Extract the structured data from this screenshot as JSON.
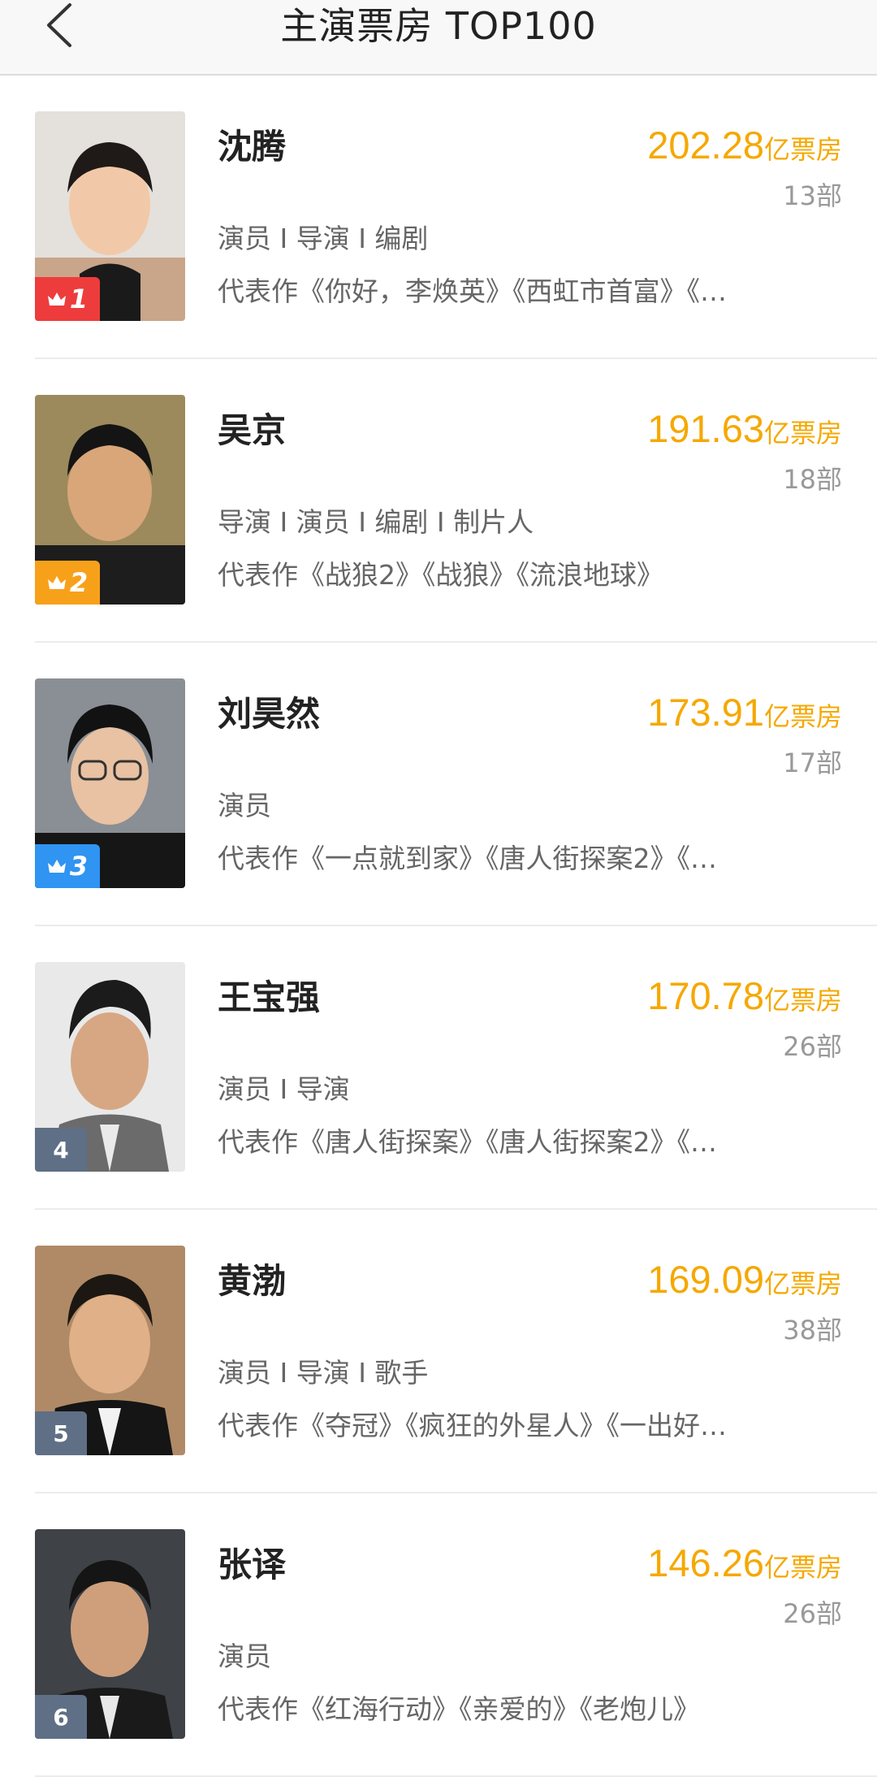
{
  "header": {
    "title": "主演票房 TOP100",
    "back_icon": "chevron-left-icon"
  },
  "colors": {
    "accent": "#f5a800",
    "rank1": "#ee3c3c",
    "rank2": "#f7a11b",
    "rank3": "#2f94f2",
    "rank_default": "#5f6f86"
  },
  "unit_label": "亿票房",
  "items": [
    {
      "rank": "1",
      "name": "沈腾",
      "box_office": "202.28",
      "films": "13部",
      "roles": "演员 I 导演 I 编剧",
      "works": "代表作《你好，李焕英》《西虹市首富》《…"
    },
    {
      "rank": "2",
      "name": "吴京",
      "box_office": "191.63",
      "films": "18部",
      "roles": "导演 I 演员 I 编剧 I 制片人",
      "works": "代表作《战狼2》《战狼》《流浪地球》"
    },
    {
      "rank": "3",
      "name": "刘昊然",
      "box_office": "173.91",
      "films": "17部",
      "roles": "演员",
      "works": "代表作《一点就到家》《唐人街探案2》《…"
    },
    {
      "rank": "4",
      "name": "王宝强",
      "box_office": "170.78",
      "films": "26部",
      "roles": "演员 I 导演",
      "works": "代表作《唐人街探案》《唐人街探案2》《…"
    },
    {
      "rank": "5",
      "name": "黄渤",
      "box_office": "169.09",
      "films": "38部",
      "roles": "演员 I 导演 I 歌手",
      "works": "代表作《夺冠》《疯狂的外星人》《一出好…"
    },
    {
      "rank": "6",
      "name": "张译",
      "box_office": "146.26",
      "films": "26部",
      "roles": "演员",
      "works": "代表作《红海行动》《亲爱的》《老炮儿》"
    }
  ]
}
